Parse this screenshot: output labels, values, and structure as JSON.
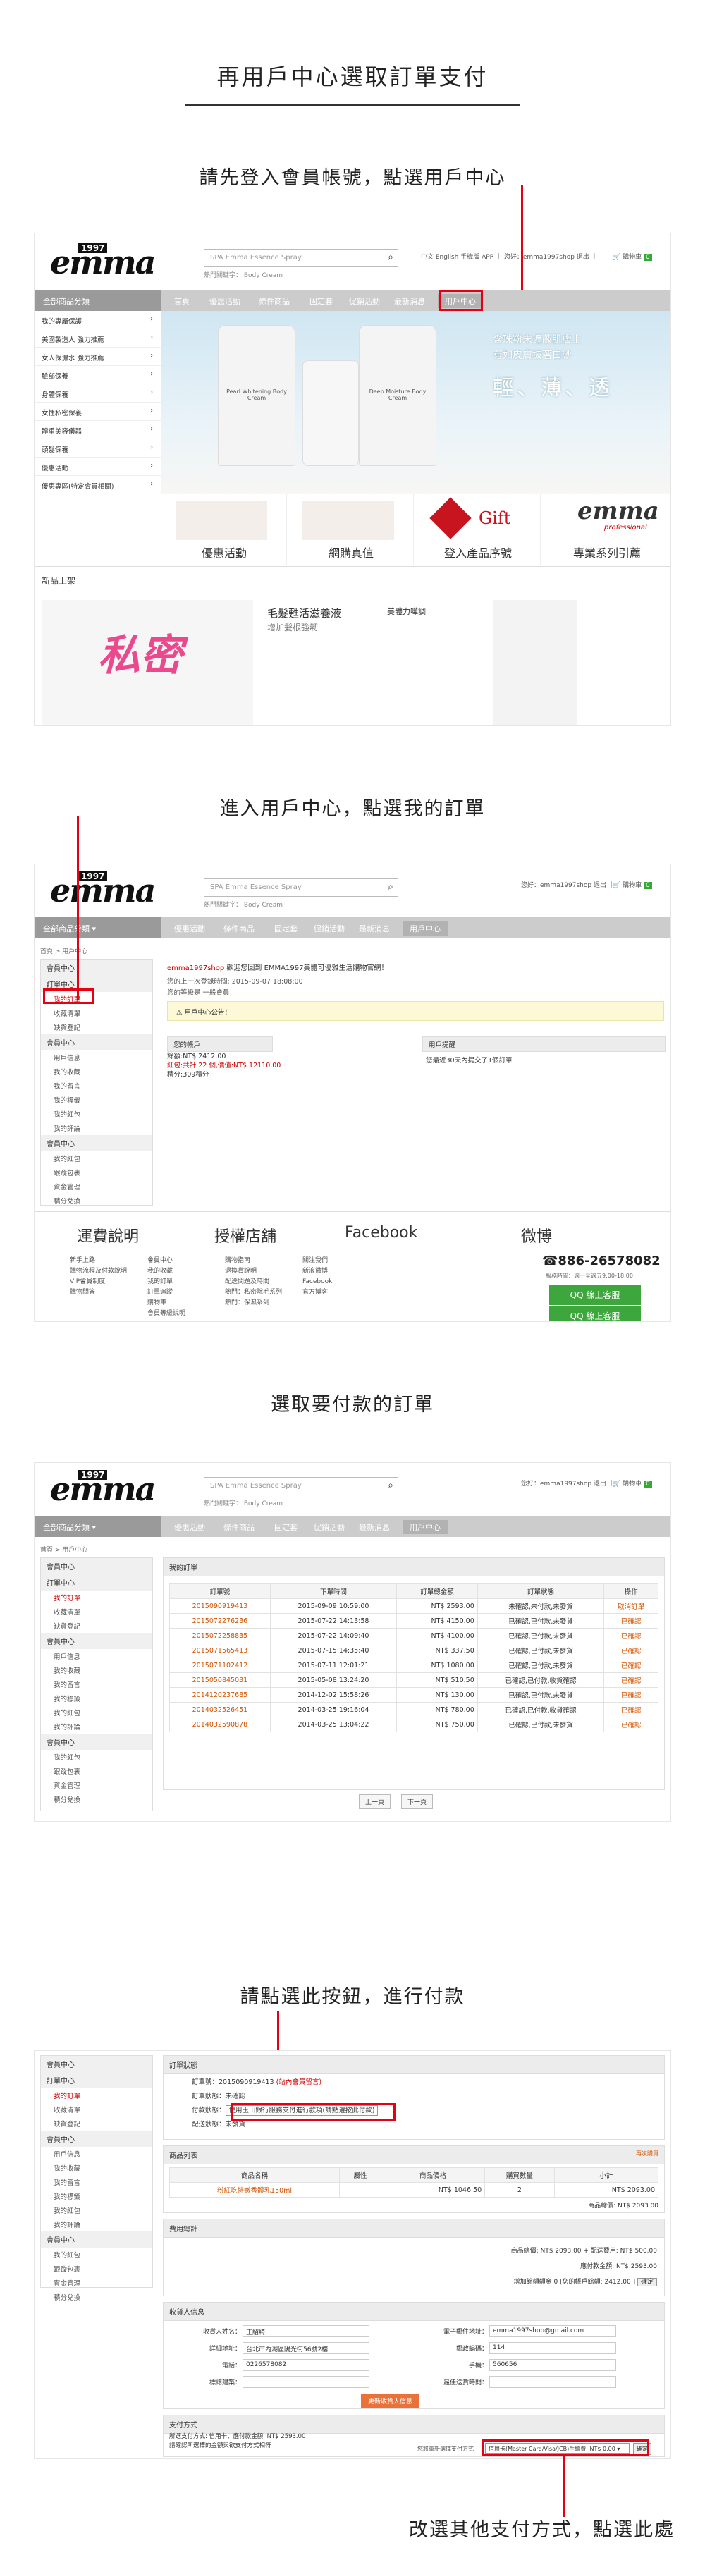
{
  "page": {
    "title": "再用戶中心選取訂單支付",
    "step1": "請先登入會員帳號，點選用戶中心",
    "step2": "進入用戶中心，點選我的訂單",
    "step3": "選取要付款的訂單",
    "step4": "請點選此按鈕，進行付款",
    "step5": "改選其他支付方式，點選此處"
  },
  "site": {
    "logo": "emma",
    "logo_year": "1997",
    "logo_professional": "professional",
    "search_placeholder": "SPA Emma Essence Spray",
    "hot_search": "熱門關鍵字：  Body Cream",
    "top_links": "中文 English 手機版 APP  ｜ 您好：emma1997shop 退出  ｜",
    "cart": "購物車",
    "cart_count": "0",
    "top_links_2": "您好：emma1997shop 退出  ｜",
    "nav_category": "全部商品分類",
    "nav_items": [
      "首頁",
      "優惠活動",
      "條件商品",
      "固定套",
      "促銷活動",
      "最新消息",
      "用戶中心"
    ]
  },
  "shot1": {
    "categories": [
      "我的專屬保護",
      "美國製造人 強力推薦",
      "女人保濕水 強力推薦",
      "臉部保養",
      "身體保養",
      "女性私密保養",
      "體重美容儀器",
      "頭髮保養",
      "優惠活動",
      "優惠專區(特定會員相關)"
    ],
    "banner_line1": "含珠粉末遮蔽肌膚上",
    "banner_line2": "有如皮膚披著白紗",
    "banner_slogan": "輕、薄、透",
    "bottle1": "Pearl Whitening Body Cream",
    "bottle2": "Deep Moisture Body Cream",
    "promo": [
      "優惠活動",
      "網購真值",
      "登入產品序號",
      "專業系列",
      "Gift"
    ],
    "promo_boxes": [
      "優惠活動",
      "網購真值",
      "登入產品序號",
      "專業系列引薦"
    ],
    "new_products": "新品上架",
    "new_text": "毛髮甦活滋養液",
    "new_sub": "增加髮根強韌",
    "new_text2": "美體力嘩調"
  },
  "shot2": {
    "breadcrumb": "首頁 > 用戶中心",
    "menu": [
      {
        "h": "會員中心"
      },
      {
        "h": "訂單中心",
        "items": [
          "我的訂單",
          "收藏清單",
          "缺貨登記"
        ],
        "on": 0
      },
      {
        "h": "會員中心",
        "items": [
          "用戶信息",
          "我的收藏",
          "我的留言",
          "我的標籤",
          "我的紅包",
          "我的評論"
        ]
      },
      {
        "h": "會員中心",
        "items": [
          "我的紅包",
          "跟蹤包裹",
          "資金管理",
          "積分兌換"
        ]
      }
    ],
    "welcome_name": "emma1997shop",
    "welcome_text": "歡迎您回到 EMMA1997美體可優雅生活購物官網！",
    "last_login": "您的上一次登錄時間: 2015-09-07 18:08:00",
    "level": "您的等級是 一般會員",
    "notice": "用戶中心公告！",
    "account_h": "您的帳戶",
    "balance": "餘額:NT$ 2412.00",
    "bonus": "紅包:共計 22 個,價值:NT$ 12110.00",
    "points": "積分:309積分",
    "reminder_h": "用戶提醒",
    "reminder": "您最近30天內提交了1個訂單",
    "footer_heads": [
      "運費說明",
      "授權店舖",
      "Facebook",
      "微博"
    ],
    "footer_col1": [
      "新手上路",
      "購物流程及付款說明",
      "VIP會員制度",
      "購物問答"
    ],
    "footer_col2": [
      "會員中心",
      "我的收藏",
      "我的訂單",
      "訂單追蹤",
      "購物車",
      "會員等級說明"
    ],
    "footer_col3": [
      "購物指南",
      "退換貨說明",
      "配送問題及時間",
      "熱門：私密除毛系列",
      "熱門：保濕系列"
    ],
    "footer_col4": [
      "關注我們",
      "新浪微博",
      "Facebook",
      "官方博客"
    ],
    "phone": "886-26578082",
    "hours": "服務時間：週一至週五9:00-18:00",
    "qq1": "QQ 線上客服",
    "qq2": "QQ 線上客服"
  },
  "shot3": {
    "panel_title": "我的訂單",
    "headers": [
      "訂單號",
      "下單時間",
      "訂單總金額",
      "訂單狀態",
      "操作"
    ],
    "rows": [
      [
        "2015090919413",
        "2015-09-09 10:59:00",
        "NT$ 2593.00",
        "未確認,未付款,未發貨",
        "取消訂單"
      ],
      [
        "2015072276236",
        "2015-07-22 14:13:58",
        "NT$ 4150.00",
        "已確認,已付款,未發貨",
        "已確認"
      ],
      [
        "2015072258835",
        "2015-07-22 14:09:40",
        "NT$ 4100.00",
        "已確認,已付款,未發貨",
        "已確認"
      ],
      [
        "2015071565413",
        "2015-07-15 14:35:40",
        "NT$ 337.50",
        "已確認,已付款,未發貨",
        "已確認"
      ],
      [
        "2015071102412",
        "2015-07-11 12:01:21",
        "NT$ 1080.00",
        "已確認,已付款,未發貨",
        "已確認"
      ],
      [
        "2015050845031",
        "2015-05-08 13:24:20",
        "NT$ 510.50",
        "已確認,已付款,收貨確認",
        "已確認"
      ],
      [
        "2014120237685",
        "2014-12-02 15:58:26",
        "NT$ 130.00",
        "已確認,已付款,未發貨",
        "已確認"
      ],
      [
        "2014032526451",
        "2014-03-25 19:16:04",
        "NT$ 780.00",
        "已確認,已付款,收貨確認",
        "已確認"
      ],
      [
        "2014032590878",
        "2014-03-25 13:04:22",
        "NT$ 750.00",
        "已確認,已付款,未發貨",
        "已確認"
      ]
    ],
    "prev": "上一頁",
    "next": "下一頁"
  },
  "shot4": {
    "status_h": "訂單狀態",
    "order_no_l": "訂單號：",
    "order_no": "2015090919413",
    "order_no_link": "(站內會員留言)",
    "order_status_l": "訂單狀態：",
    "order_status": "未確認",
    "pay_status_l": "付款狀態：",
    "pay_button": "使用玉山銀行服務支付進行款項(請點選按此付款)",
    "ship_status_l": "配送狀態：",
    "ship_status": "未發貨",
    "goods_h": "商品列表",
    "goods_link": "再次購買",
    "goods_headers": [
      "商品名稱",
      "屬性",
      "商品價格",
      "購買數量",
      "小計"
    ],
    "goods_row": [
      "粉紅吃特嫩香體乳150ml",
      "",
      "NT$ 1046.50",
      "2",
      "NT$ 2093.00"
    ],
    "goods_total": "商品總價: NT$ 2093.00",
    "fee_h": "費用總計",
    "fee_line1": "商品總價: NT$ 2093.00 + 配送費用: NT$ 500.00",
    "fee_line2": "應付款金額: NT$ 2593.00",
    "balance_line": "增加餘額額金 0  [您的帳戶餘額: 2412.00 ]",
    "confirm": "確定",
    "recv_h": "收貨人信息",
    "recv_labels": [
      "收貨人姓名：",
      "詳細地址：",
      "電話：",
      "標誌建築："
    ],
    "recv_values": [
      "王紹綺",
      "台北市內湖區陽光街56號2樓",
      "0226578082",
      ""
    ],
    "recv_labels2": [
      "電子郵件地址：",
      "郵政編碼：",
      "手機：",
      "最佳送貨時間："
    ],
    "recv_values2": [
      "emma1997shop@gmail.com",
      "114",
      "560656",
      ""
    ],
    "update_btn": "更新收貨人信息",
    "pay_h": "支付方式",
    "pay_text1": "所選支付方式: 信用卡，應付款金額: NT$ 2593.00",
    "pay_text2": "請確認所選擇的金額與欲支付方式相符",
    "pay_select_label": "您將重新選擇支付方式",
    "pay_select": "信用卡(Master Card/Visa/JCB)手續費: NT$ 0.00",
    "pay_confirm": "確定"
  }
}
